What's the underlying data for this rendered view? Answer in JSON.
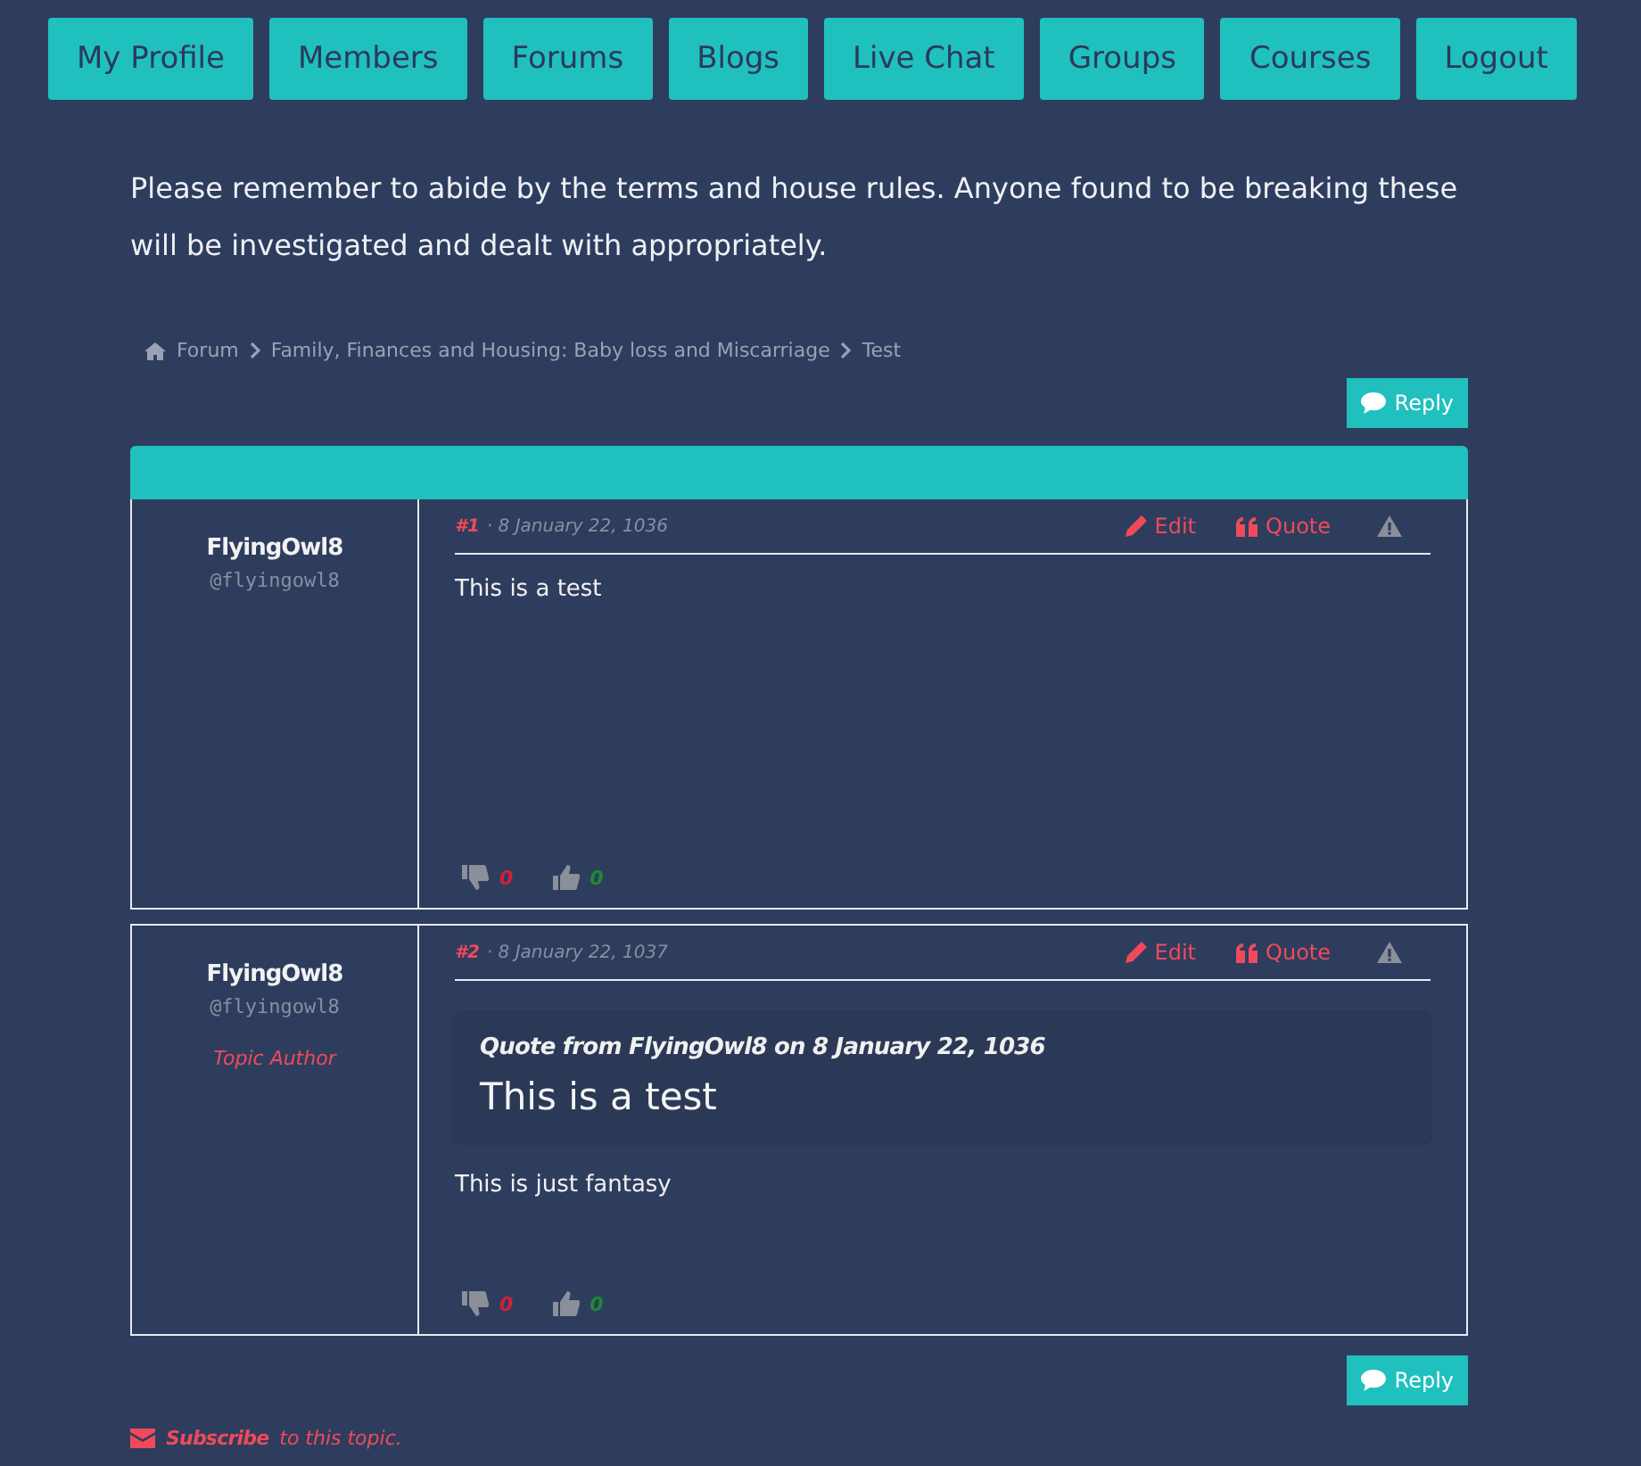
{
  "nav": [
    {
      "label": "My Profile"
    },
    {
      "label": "Members"
    },
    {
      "label": "Forums"
    },
    {
      "label": "Blogs"
    },
    {
      "label": "Live Chat"
    },
    {
      "label": "Groups"
    },
    {
      "label": "Courses"
    },
    {
      "label": "Logout"
    }
  ],
  "notice": "Please remember to abide by the terms and house rules. Anyone found to be breaking these will be investigated and dealt with appropriately.",
  "breadcrumb": [
    "Forum",
    "Family, Finances and Housing: Baby loss and Miscarriage",
    "Test"
  ],
  "reply_label": "Reply",
  "posts": [
    {
      "author": "FlyingOwl8",
      "handle": "@flyingowl8",
      "number": "#1",
      "date": "· 8 January 22, 1036",
      "edit": "Edit",
      "quote": "Quote",
      "body": "This is a test",
      "downvotes": "0",
      "upvotes": "0"
    },
    {
      "author": "FlyingOwl8",
      "handle": "@flyingowl8",
      "role": "Topic Author",
      "number": "#2",
      "date": "· 8 January 22, 1037",
      "edit": "Edit",
      "quote": "Quote",
      "quoted": {
        "heading": "Quote from FlyingOwl8 on 8 January 22, 1036",
        "text": "This is a test"
      },
      "body": "This is just fantasy",
      "downvotes": "0",
      "upvotes": "0"
    }
  ],
  "reply_bottom_label": "Reply",
  "subscribe": {
    "link": "Subscribe",
    "text": "to this topic."
  }
}
